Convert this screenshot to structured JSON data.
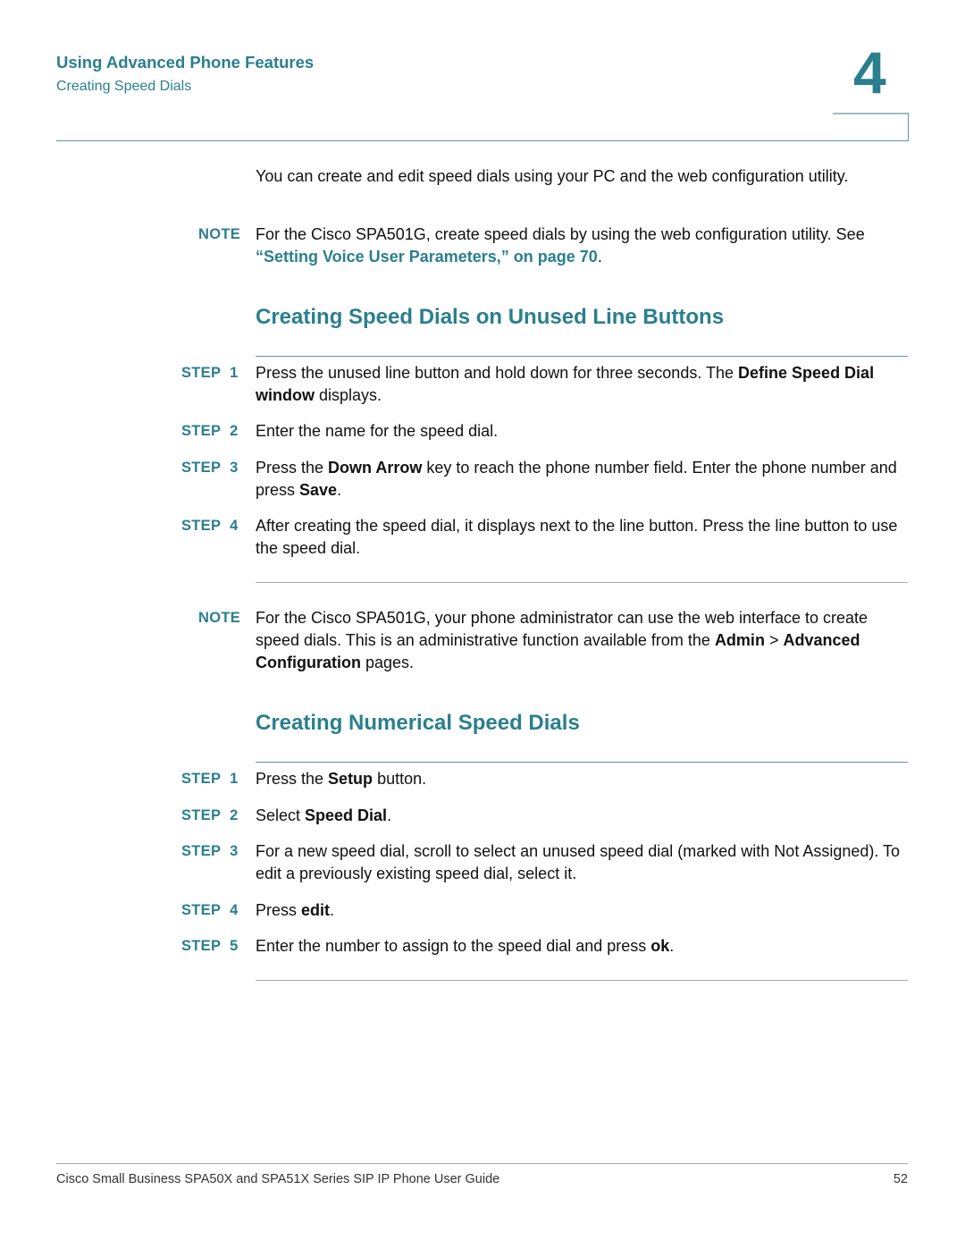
{
  "header": {
    "chapter_title": "Using Advanced Phone Features",
    "section": "Creating Speed Dials",
    "chapter_number": "4"
  },
  "intro": {
    "text": "You can create and edit speed dials using your PC and the web configuration utility."
  },
  "note1": {
    "label": "NOTE",
    "text": "For the Cisco SPA501G, create speed dials by using the web configuration utility. See ",
    "link": "“Setting Voice User Parameters,” on page 70",
    "after": "."
  },
  "section1": {
    "title": "Creating Speed Dials on Unused Line Buttons",
    "steps": [
      {
        "label": "STEP",
        "num": "1",
        "parts": [
          {
            "t": "Press the unused line button and hold down for three seconds. The ",
            "b": false
          },
          {
            "t": "Define Speed Dial window",
            "b": true
          },
          {
            "t": " displays.",
            "b": false
          }
        ]
      },
      {
        "label": "STEP",
        "num": "2",
        "parts": [
          {
            "t": "Enter the name for the speed dial.",
            "b": false
          }
        ]
      },
      {
        "label": "STEP",
        "num": "3",
        "parts": [
          {
            "t": "Press the ",
            "b": false
          },
          {
            "t": "Down Arrow",
            "b": true
          },
          {
            "t": " key to reach the phone number field. Enter the phone number and press ",
            "b": false
          },
          {
            "t": "Save",
            "b": true
          },
          {
            "t": ".",
            "b": false
          }
        ]
      },
      {
        "label": "STEP",
        "num": "4",
        "parts": [
          {
            "t": "After creating the speed dial, it displays next to the line button. Press the line button to use the speed dial.",
            "b": false
          }
        ]
      }
    ]
  },
  "note2": {
    "label": "NOTE",
    "parts": [
      {
        "t": "For the Cisco SPA501G, your phone administrator can use the web interface to create speed dials. This is an administrative function available from the ",
        "b": false
      },
      {
        "t": "Admin",
        "b": true
      },
      {
        "t": " > ",
        "b": false
      },
      {
        "t": "Advanced Configuration",
        "b": true
      },
      {
        "t": " pages.",
        "b": false
      }
    ]
  },
  "section2": {
    "title": "Creating Numerical Speed Dials",
    "steps": [
      {
        "label": "STEP",
        "num": "1",
        "parts": [
          {
            "t": "Press the ",
            "b": false
          },
          {
            "t": "Setup",
            "b": true
          },
          {
            "t": " button.",
            "b": false
          }
        ]
      },
      {
        "label": "STEP",
        "num": "2",
        "parts": [
          {
            "t": "Select ",
            "b": false
          },
          {
            "t": "Speed Dial",
            "b": true
          },
          {
            "t": ".",
            "b": false
          }
        ]
      },
      {
        "label": "STEP",
        "num": "3",
        "parts": [
          {
            "t": "For a new speed dial, scroll to select an unused speed dial (marked with Not Assigned). To edit a previously existing speed dial, select it.",
            "b": false
          }
        ]
      },
      {
        "label": "STEP",
        "num": "4",
        "parts": [
          {
            "t": "Press ",
            "b": false
          },
          {
            "t": "edit",
            "b": true
          },
          {
            "t": ".",
            "b": false
          }
        ]
      },
      {
        "label": "STEP",
        "num": "5",
        "parts": [
          {
            "t": "Enter the number to assign to the speed dial and press ",
            "b": false
          },
          {
            "t": "ok",
            "b": true
          },
          {
            "t": ".",
            "b": false
          }
        ]
      }
    ]
  },
  "footer": {
    "title": "Cisco Small Business SPA50X and SPA51X Series SIP IP Phone User Guide",
    "page": "52"
  }
}
